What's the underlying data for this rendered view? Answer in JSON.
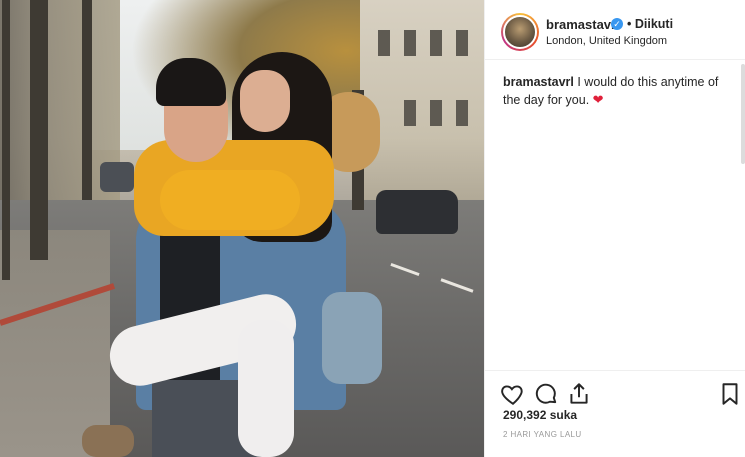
{
  "post": {
    "photo_description_icon": "photo",
    "username": "bramastavrl",
    "verified_icon": "verified-badge-icon",
    "follow_status": "• Diikuti",
    "location": "London, United Kingdom",
    "caption_username": "bramastavrl",
    "caption_text": " I would do this anytime of the day for you. ",
    "caption_emoji": "❤",
    "likes": "290,392 suka",
    "timestamp": "2 HARI YANG LALU"
  },
  "actions": {
    "like_icon": "heart-outline-icon",
    "comment_icon": "comment-bubble-icon",
    "share_icon": "share-upload-icon",
    "save_icon": "bookmark-icon"
  },
  "colors": {
    "verified": "#3897f0",
    "heart": "#e0203a",
    "text": "#262626",
    "muted": "#999999"
  }
}
